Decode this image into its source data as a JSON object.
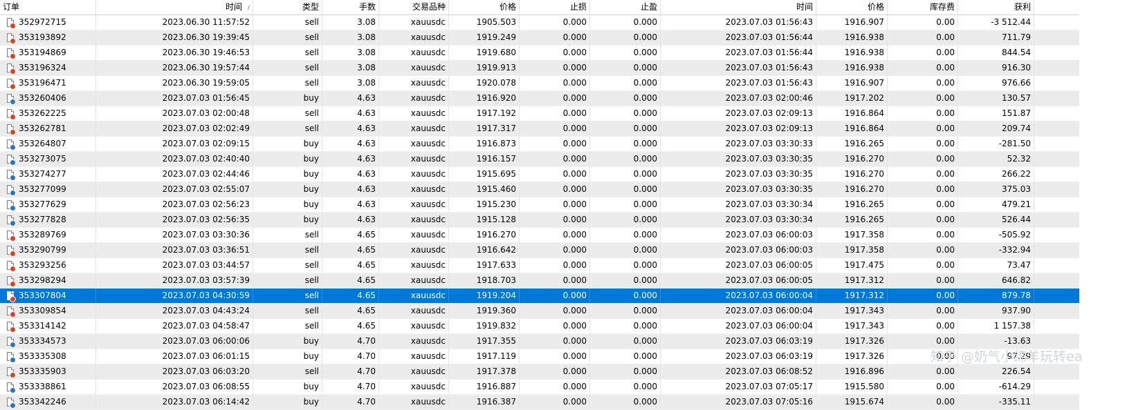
{
  "columns": {
    "order": "订单",
    "time_open": "时间",
    "sort_indicator": "/",
    "type": "类型",
    "lots": "手数",
    "symbol": "交易品种",
    "price_open": "价格",
    "sl": "止损",
    "tp": "止盈",
    "time_close": "时间",
    "price_close": "价格",
    "swap": "库存费",
    "profit": "获利"
  },
  "selected_row_index": 18,
  "colors": {
    "selected_bg": "#0078d7",
    "stripe_bg": "#ececec",
    "sell_dot": "#e0401e",
    "buy_dot": "#1e78d0"
  },
  "rows": [
    {
      "order": "352972715",
      "time_open": "2023.06.30 11:57:52",
      "type": "sell",
      "lots": "3.08",
      "symbol": "xauusdc",
      "price_open": "1905.503",
      "sl": "0.000",
      "tp": "0.000",
      "time_close": "2023.07.03 01:56:43",
      "price_close": "1916.907",
      "swap": "0.00",
      "profit": "-3 512.44"
    },
    {
      "order": "353193892",
      "time_open": "2023.06.30 19:39:45",
      "type": "sell",
      "lots": "3.08",
      "symbol": "xauusdc",
      "price_open": "1919.249",
      "sl": "0.000",
      "tp": "0.000",
      "time_close": "2023.07.03 01:56:44",
      "price_close": "1916.938",
      "swap": "0.00",
      "profit": "711.79"
    },
    {
      "order": "353194869",
      "time_open": "2023.06.30 19:46:53",
      "type": "sell",
      "lots": "3.08",
      "symbol": "xauusdc",
      "price_open": "1919.680",
      "sl": "0.000",
      "tp": "0.000",
      "time_close": "2023.07.03 01:56:44",
      "price_close": "1916.938",
      "swap": "0.00",
      "profit": "844.54"
    },
    {
      "order": "353196324",
      "time_open": "2023.06.30 19:57:44",
      "type": "sell",
      "lots": "3.08",
      "symbol": "xauusdc",
      "price_open": "1919.913",
      "sl": "0.000",
      "tp": "0.000",
      "time_close": "2023.07.03 01:56:43",
      "price_close": "1916.938",
      "swap": "0.00",
      "profit": "916.30"
    },
    {
      "order": "353196471",
      "time_open": "2023.06.30 19:59:05",
      "type": "sell",
      "lots": "3.08",
      "symbol": "xauusdc",
      "price_open": "1920.078",
      "sl": "0.000",
      "tp": "0.000",
      "time_close": "2023.07.03 01:56:43",
      "price_close": "1916.907",
      "swap": "0.00",
      "profit": "976.66"
    },
    {
      "order": "353260406",
      "time_open": "2023.07.03 01:56:45",
      "type": "buy",
      "lots": "4.63",
      "symbol": "xauusdc",
      "price_open": "1916.920",
      "sl": "0.000",
      "tp": "0.000",
      "time_close": "2023.07.03 02:00:46",
      "price_close": "1917.202",
      "swap": "0.00",
      "profit": "130.57"
    },
    {
      "order": "353262225",
      "time_open": "2023.07.03 02:00:48",
      "type": "sell",
      "lots": "4.63",
      "symbol": "xauusdc",
      "price_open": "1917.192",
      "sl": "0.000",
      "tp": "0.000",
      "time_close": "2023.07.03 02:09:13",
      "price_close": "1916.864",
      "swap": "0.00",
      "profit": "151.87"
    },
    {
      "order": "353262781",
      "time_open": "2023.07.03 02:02:49",
      "type": "sell",
      "lots": "4.63",
      "symbol": "xauusdc",
      "price_open": "1917.317",
      "sl": "0.000",
      "tp": "0.000",
      "time_close": "2023.07.03 02:09:13",
      "price_close": "1916.864",
      "swap": "0.00",
      "profit": "209.74"
    },
    {
      "order": "353264807",
      "time_open": "2023.07.03 02:09:15",
      "type": "buy",
      "lots": "4.63",
      "symbol": "xauusdc",
      "price_open": "1916.873",
      "sl": "0.000",
      "tp": "0.000",
      "time_close": "2023.07.03 03:30:33",
      "price_close": "1916.265",
      "swap": "0.00",
      "profit": "-281.50"
    },
    {
      "order": "353273075",
      "time_open": "2023.07.03 02:40:40",
      "type": "buy",
      "lots": "4.63",
      "symbol": "xauusdc",
      "price_open": "1916.157",
      "sl": "0.000",
      "tp": "0.000",
      "time_close": "2023.07.03 03:30:35",
      "price_close": "1916.270",
      "swap": "0.00",
      "profit": "52.32"
    },
    {
      "order": "353274277",
      "time_open": "2023.07.03 02:44:46",
      "type": "buy",
      "lots": "4.63",
      "symbol": "xauusdc",
      "price_open": "1915.695",
      "sl": "0.000",
      "tp": "0.000",
      "time_close": "2023.07.03 03:30:35",
      "price_close": "1916.270",
      "swap": "0.00",
      "profit": "266.22"
    },
    {
      "order": "353277099",
      "time_open": "2023.07.03 02:55:07",
      "type": "buy",
      "lots": "4.63",
      "symbol": "xauusdc",
      "price_open": "1915.460",
      "sl": "0.000",
      "tp": "0.000",
      "time_close": "2023.07.03 03:30:35",
      "price_close": "1916.270",
      "swap": "0.00",
      "profit": "375.03"
    },
    {
      "order": "353277629",
      "time_open": "2023.07.03 02:56:23",
      "type": "buy",
      "lots": "4.63",
      "symbol": "xauusdc",
      "price_open": "1915.230",
      "sl": "0.000",
      "tp": "0.000",
      "time_close": "2023.07.03 03:30:34",
      "price_close": "1916.265",
      "swap": "0.00",
      "profit": "479.21"
    },
    {
      "order": "353277828",
      "time_open": "2023.07.03 02:56:35",
      "type": "buy",
      "lots": "4.63",
      "symbol": "xauusdc",
      "price_open": "1915.128",
      "sl": "0.000",
      "tp": "0.000",
      "time_close": "2023.07.03 03:30:34",
      "price_close": "1916.265",
      "swap": "0.00",
      "profit": "526.44"
    },
    {
      "order": "353289769",
      "time_open": "2023.07.03 03:30:36",
      "type": "sell",
      "lots": "4.65",
      "symbol": "xauusdc",
      "price_open": "1916.270",
      "sl": "0.000",
      "tp": "0.000",
      "time_close": "2023.07.03 06:00:03",
      "price_close": "1917.358",
      "swap": "0.00",
      "profit": "-505.92"
    },
    {
      "order": "353290799",
      "time_open": "2023.07.03 03:36:51",
      "type": "sell",
      "lots": "4.65",
      "symbol": "xauusdc",
      "price_open": "1916.642",
      "sl": "0.000",
      "tp": "0.000",
      "time_close": "2023.07.03 06:00:03",
      "price_close": "1917.358",
      "swap": "0.00",
      "profit": "-332.94"
    },
    {
      "order": "353293256",
      "time_open": "2023.07.03 03:44:57",
      "type": "sell",
      "lots": "4.65",
      "symbol": "xauusdc",
      "price_open": "1917.633",
      "sl": "0.000",
      "tp": "0.000",
      "time_close": "2023.07.03 06:00:05",
      "price_close": "1917.475",
      "swap": "0.00",
      "profit": "73.47"
    },
    {
      "order": "353298294",
      "time_open": "2023.07.03 03:57:39",
      "type": "sell",
      "lots": "4.65",
      "symbol": "xauusdc",
      "price_open": "1918.703",
      "sl": "0.000",
      "tp": "0.000",
      "time_close": "2023.07.03 06:00:05",
      "price_close": "1917.312",
      "swap": "0.00",
      "profit": "646.82"
    },
    {
      "order": "353307804",
      "time_open": "2023.07.03 04:30:59",
      "type": "sell",
      "lots": "4.65",
      "symbol": "xauusdc",
      "price_open": "1919.204",
      "sl": "0.000",
      "tp": "0.000",
      "time_close": "2023.07.03 06:00:04",
      "price_close": "1917.312",
      "swap": "0.00",
      "profit": "879.78"
    },
    {
      "order": "353309854",
      "time_open": "2023.07.03 04:43:24",
      "type": "sell",
      "lots": "4.65",
      "symbol": "xauusdc",
      "price_open": "1919.360",
      "sl": "0.000",
      "tp": "0.000",
      "time_close": "2023.07.03 06:00:04",
      "price_close": "1917.343",
      "swap": "0.00",
      "profit": "937.90"
    },
    {
      "order": "353314142",
      "time_open": "2023.07.03 04:58:47",
      "type": "sell",
      "lots": "4.65",
      "symbol": "xauusdc",
      "price_open": "1919.832",
      "sl": "0.000",
      "tp": "0.000",
      "time_close": "2023.07.03 06:00:04",
      "price_close": "1917.343",
      "swap": "0.00",
      "profit": "1 157.38"
    },
    {
      "order": "353334573",
      "time_open": "2023.07.03 06:00:06",
      "type": "buy",
      "lots": "4.70",
      "symbol": "xauusdc",
      "price_open": "1917.355",
      "sl": "0.000",
      "tp": "0.000",
      "time_close": "2023.07.03 06:03:19",
      "price_close": "1917.326",
      "swap": "0.00",
      "profit": "-13.63"
    },
    {
      "order": "353335308",
      "time_open": "2023.07.03 06:01:15",
      "type": "buy",
      "lots": "4.70",
      "symbol": "xauusdc",
      "price_open": "1917.119",
      "sl": "0.000",
      "tp": "0.000",
      "time_close": "2023.07.03 06:03:19",
      "price_close": "1917.326",
      "swap": "0.00",
      "profit": "97.29"
    },
    {
      "order": "353335903",
      "time_open": "2023.07.03 06:03:20",
      "type": "sell",
      "lots": "4.70",
      "symbol": "xauusdc",
      "price_open": "1917.378",
      "sl": "0.000",
      "tp": "0.000",
      "time_close": "2023.07.03 06:08:52",
      "price_close": "1916.896",
      "swap": "0.00",
      "profit": "226.54"
    },
    {
      "order": "353338861",
      "time_open": "2023.07.03 06:08:55",
      "type": "buy",
      "lots": "4.70",
      "symbol": "xauusdc",
      "price_open": "1916.887",
      "sl": "0.000",
      "tp": "0.000",
      "time_close": "2023.07.03 07:05:17",
      "price_close": "1915.580",
      "swap": "0.00",
      "profit": "-614.29"
    },
    {
      "order": "353342246",
      "time_open": "2023.07.03 06:14:42",
      "type": "buy",
      "lots": "4.70",
      "symbol": "xauusdc",
      "price_open": "1916.387",
      "sl": "0.000",
      "tp": "0.000",
      "time_close": "2023.07.03 07:05:16",
      "price_close": "1915.674",
      "swap": "0.00",
      "profit": "-335.11"
    }
  ],
  "watermark": "知乎 @奶气小绵羊玩转ea"
}
